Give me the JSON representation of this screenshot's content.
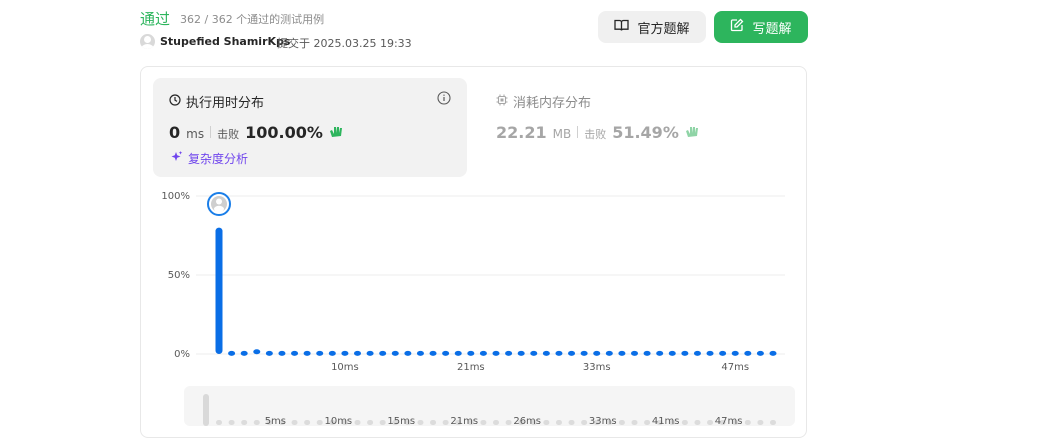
{
  "header": {
    "status": "通过",
    "cases": "362 / 362 个通过的测试用例",
    "user": "Stupefied ShamirKps",
    "submitted": "提交于 2025.03.25 19:33",
    "btn_official": "官方题解",
    "btn_write": "写题解"
  },
  "runtime": {
    "title": "执行用时分布",
    "value": "0",
    "unit": "ms",
    "beat_label": "击败",
    "beat": "100.00%",
    "complexity": "复杂度分析"
  },
  "memory": {
    "title": "消耗内存分布",
    "value": "22.21",
    "unit": "MB",
    "beat_label": "击败",
    "beat": "51.49%"
  },
  "chart_data": {
    "type": "bar",
    "y_ticks": [
      "100%",
      "50%",
      "0%"
    ],
    "x_ticks": [
      "10ms",
      "21ms",
      "33ms",
      "47ms"
    ],
    "ylim": [
      0,
      100
    ],
    "bar_count": 45,
    "values": [
      80,
      2,
      2,
      3,
      2,
      2,
      2,
      2,
      2,
      2,
      2,
      2,
      2,
      2,
      2,
      2,
      2,
      2,
      2,
      2,
      2,
      2,
      2,
      2,
      2,
      2,
      2,
      2,
      2,
      2,
      2,
      2,
      2,
      2,
      2,
      2,
      2,
      2,
      2,
      2,
      2,
      2,
      2,
      2,
      2
    ],
    "highlight_index": 0,
    "grid": true,
    "bar_color": "#0a6ee6"
  },
  "scrubber": {
    "ticks": [
      "5ms",
      "10ms",
      "15ms",
      "21ms",
      "26ms",
      "33ms",
      "41ms",
      "47ms"
    ]
  }
}
